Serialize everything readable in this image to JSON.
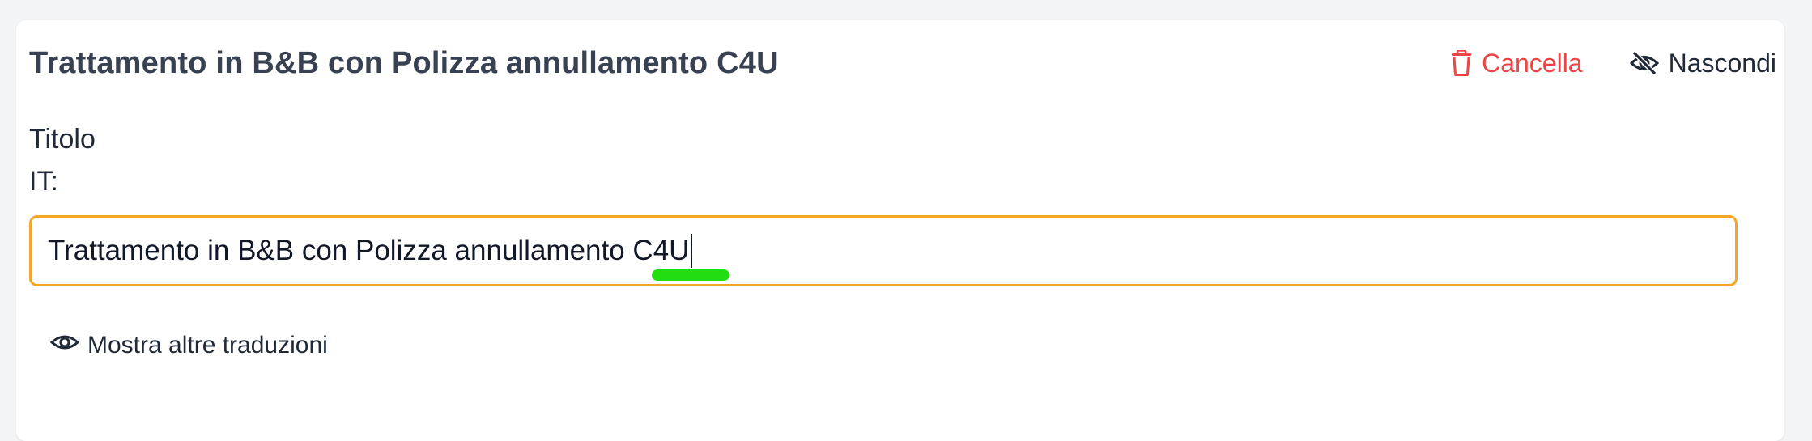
{
  "card": {
    "title": "Trattamento in B&B con Polizza annullamento C4U",
    "actions": {
      "delete_label": "Cancella",
      "delete_icon": "trash-icon",
      "hide_label": "Nascondi",
      "hide_icon": "eye-off-icon"
    }
  },
  "field": {
    "label": "Titolo",
    "language_label": "IT:",
    "value": "Trattamento in B&B con Polizza annullamento C4U"
  },
  "translations_toggle": {
    "label": "Mostra altre traduzioni",
    "icon": "eye-icon"
  },
  "colors": {
    "accent_focus": "#f5a623",
    "danger": "#ef4444",
    "highlight": "#22dd11"
  }
}
